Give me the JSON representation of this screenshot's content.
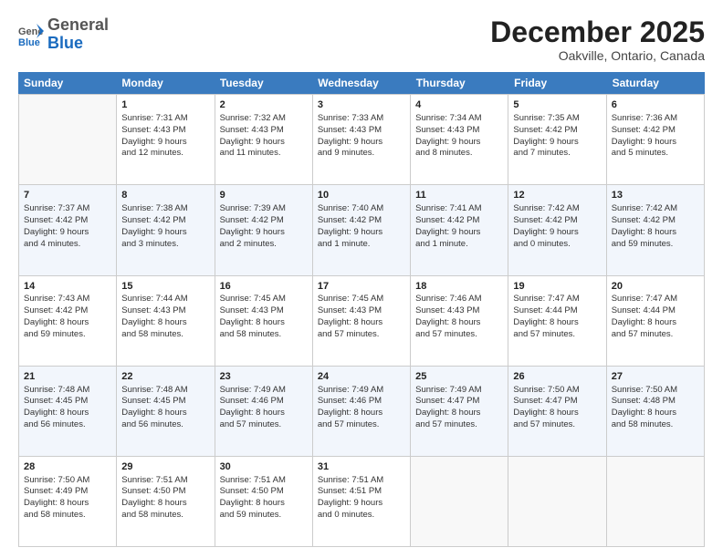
{
  "header": {
    "logo_general": "General",
    "logo_blue": "Blue",
    "month": "December 2025",
    "location": "Oakville, Ontario, Canada"
  },
  "days_of_week": [
    "Sunday",
    "Monday",
    "Tuesday",
    "Wednesday",
    "Thursday",
    "Friday",
    "Saturday"
  ],
  "weeks": [
    [
      {
        "day": "",
        "info": ""
      },
      {
        "day": "1",
        "info": "Sunrise: 7:31 AM\nSunset: 4:43 PM\nDaylight: 9 hours\nand 12 minutes."
      },
      {
        "day": "2",
        "info": "Sunrise: 7:32 AM\nSunset: 4:43 PM\nDaylight: 9 hours\nand 11 minutes."
      },
      {
        "day": "3",
        "info": "Sunrise: 7:33 AM\nSunset: 4:43 PM\nDaylight: 9 hours\nand 9 minutes."
      },
      {
        "day": "4",
        "info": "Sunrise: 7:34 AM\nSunset: 4:43 PM\nDaylight: 9 hours\nand 8 minutes."
      },
      {
        "day": "5",
        "info": "Sunrise: 7:35 AM\nSunset: 4:42 PM\nDaylight: 9 hours\nand 7 minutes."
      },
      {
        "day": "6",
        "info": "Sunrise: 7:36 AM\nSunset: 4:42 PM\nDaylight: 9 hours\nand 5 minutes."
      }
    ],
    [
      {
        "day": "7",
        "info": "Sunrise: 7:37 AM\nSunset: 4:42 PM\nDaylight: 9 hours\nand 4 minutes."
      },
      {
        "day": "8",
        "info": "Sunrise: 7:38 AM\nSunset: 4:42 PM\nDaylight: 9 hours\nand 3 minutes."
      },
      {
        "day": "9",
        "info": "Sunrise: 7:39 AM\nSunset: 4:42 PM\nDaylight: 9 hours\nand 2 minutes."
      },
      {
        "day": "10",
        "info": "Sunrise: 7:40 AM\nSunset: 4:42 PM\nDaylight: 9 hours\nand 1 minute."
      },
      {
        "day": "11",
        "info": "Sunrise: 7:41 AM\nSunset: 4:42 PM\nDaylight: 9 hours\nand 1 minute."
      },
      {
        "day": "12",
        "info": "Sunrise: 7:42 AM\nSunset: 4:42 PM\nDaylight: 9 hours\nand 0 minutes."
      },
      {
        "day": "13",
        "info": "Sunrise: 7:42 AM\nSunset: 4:42 PM\nDaylight: 8 hours\nand 59 minutes."
      }
    ],
    [
      {
        "day": "14",
        "info": "Sunrise: 7:43 AM\nSunset: 4:42 PM\nDaylight: 8 hours\nand 59 minutes."
      },
      {
        "day": "15",
        "info": "Sunrise: 7:44 AM\nSunset: 4:43 PM\nDaylight: 8 hours\nand 58 minutes."
      },
      {
        "day": "16",
        "info": "Sunrise: 7:45 AM\nSunset: 4:43 PM\nDaylight: 8 hours\nand 58 minutes."
      },
      {
        "day": "17",
        "info": "Sunrise: 7:45 AM\nSunset: 4:43 PM\nDaylight: 8 hours\nand 57 minutes."
      },
      {
        "day": "18",
        "info": "Sunrise: 7:46 AM\nSunset: 4:43 PM\nDaylight: 8 hours\nand 57 minutes."
      },
      {
        "day": "19",
        "info": "Sunrise: 7:47 AM\nSunset: 4:44 PM\nDaylight: 8 hours\nand 57 minutes."
      },
      {
        "day": "20",
        "info": "Sunrise: 7:47 AM\nSunset: 4:44 PM\nDaylight: 8 hours\nand 57 minutes."
      }
    ],
    [
      {
        "day": "21",
        "info": "Sunrise: 7:48 AM\nSunset: 4:45 PM\nDaylight: 8 hours\nand 56 minutes."
      },
      {
        "day": "22",
        "info": "Sunrise: 7:48 AM\nSunset: 4:45 PM\nDaylight: 8 hours\nand 56 minutes."
      },
      {
        "day": "23",
        "info": "Sunrise: 7:49 AM\nSunset: 4:46 PM\nDaylight: 8 hours\nand 57 minutes."
      },
      {
        "day": "24",
        "info": "Sunrise: 7:49 AM\nSunset: 4:46 PM\nDaylight: 8 hours\nand 57 minutes."
      },
      {
        "day": "25",
        "info": "Sunrise: 7:49 AM\nSunset: 4:47 PM\nDaylight: 8 hours\nand 57 minutes."
      },
      {
        "day": "26",
        "info": "Sunrise: 7:50 AM\nSunset: 4:47 PM\nDaylight: 8 hours\nand 57 minutes."
      },
      {
        "day": "27",
        "info": "Sunrise: 7:50 AM\nSunset: 4:48 PM\nDaylight: 8 hours\nand 58 minutes."
      }
    ],
    [
      {
        "day": "28",
        "info": "Sunrise: 7:50 AM\nSunset: 4:49 PM\nDaylight: 8 hours\nand 58 minutes."
      },
      {
        "day": "29",
        "info": "Sunrise: 7:51 AM\nSunset: 4:50 PM\nDaylight: 8 hours\nand 58 minutes."
      },
      {
        "day": "30",
        "info": "Sunrise: 7:51 AM\nSunset: 4:50 PM\nDaylight: 8 hours\nand 59 minutes."
      },
      {
        "day": "31",
        "info": "Sunrise: 7:51 AM\nSunset: 4:51 PM\nDaylight: 9 hours\nand 0 minutes."
      },
      {
        "day": "",
        "info": ""
      },
      {
        "day": "",
        "info": ""
      },
      {
        "day": "",
        "info": ""
      }
    ]
  ]
}
